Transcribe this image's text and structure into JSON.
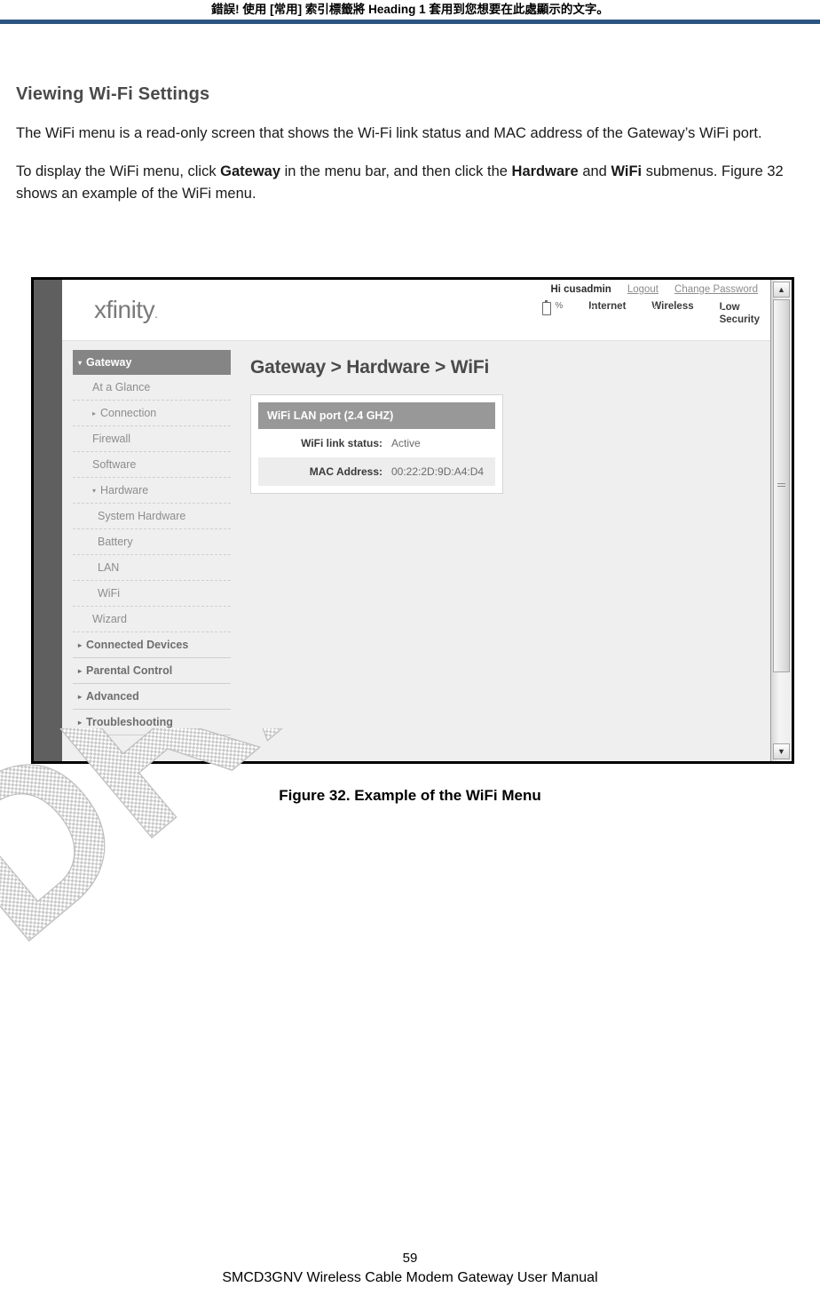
{
  "document": {
    "header_note": "錯誤! 使用 [常用] 索引標籤將 Heading 1 套用到您想要在此處顯示的文字。",
    "rule_color": "#2b5580",
    "section_title": "Viewing Wi-Fi Settings",
    "paragraph_1": "The WiFi menu is a read-only screen that shows the Wi-Fi link status and MAC address of the Gateway’s WiFi port.",
    "paragraph_2_part1": "To display the WiFi menu, click ",
    "paragraph_2_bold1": "Gateway",
    "paragraph_2_part2": " in the menu bar, and then click the ",
    "paragraph_2_bold2": "Hardware",
    "paragraph_2_part3": " and ",
    "paragraph_2_bold3": "WiFi",
    "paragraph_2_part4": " submenus. Figure 32 shows an example of the WiFi menu.",
    "figure_caption": "Figure 32. Example of the WiFi Menu",
    "watermark": "DRAFT",
    "page_number": "59",
    "footer": "SMCD3GNV Wireless Cable Modem Gateway User Manual"
  },
  "screenshot": {
    "logo": "xfinity",
    "logo_dot": ".",
    "topbar": {
      "greeting": "Hi cusadmin",
      "logout": "Logout",
      "change_password": "Change Password",
      "battery_percent": "%",
      "internet": "Internet",
      "wireless": "Wireless",
      "security_line1": "Low",
      "security_line2": "Security"
    },
    "sidebar": {
      "items": [
        {
          "label": "Gateway",
          "level": "top",
          "state": "active",
          "marker": "▾"
        },
        {
          "label": "At a Glance",
          "level": "child",
          "state": "normal",
          "marker": ""
        },
        {
          "label": "Connection",
          "level": "child",
          "state": "normal",
          "marker": "▸"
        },
        {
          "label": "Firewall",
          "level": "child",
          "state": "normal",
          "marker": ""
        },
        {
          "label": "Software",
          "level": "child",
          "state": "normal",
          "marker": ""
        },
        {
          "label": "Hardware",
          "level": "child",
          "state": "expanded",
          "marker": "▾"
        },
        {
          "label": "System Hardware",
          "level": "grandchild",
          "state": "normal",
          "marker": ""
        },
        {
          "label": "Battery",
          "level": "grandchild",
          "state": "normal",
          "marker": ""
        },
        {
          "label": "LAN",
          "level": "grandchild",
          "state": "normal",
          "marker": ""
        },
        {
          "label": "WiFi",
          "level": "grandchild",
          "state": "current",
          "marker": ""
        },
        {
          "label": "Wizard",
          "level": "child",
          "state": "normal",
          "marker": ""
        },
        {
          "label": "Connected Devices",
          "level": "top",
          "state": "normal",
          "marker": "▸"
        },
        {
          "label": "Parental Control",
          "level": "top",
          "state": "normal",
          "marker": "▸"
        },
        {
          "label": "Advanced",
          "level": "top",
          "state": "normal",
          "marker": "▸"
        },
        {
          "label": "Troubleshooting",
          "level": "top",
          "state": "normal",
          "marker": "▸"
        }
      ]
    },
    "main": {
      "breadcrumb": "Gateway > Hardware > WiFi",
      "panel_title": "WiFi LAN port (2.4 GHZ)",
      "rows": [
        {
          "label": "WiFi link status:",
          "value": "Active"
        },
        {
          "label": "MAC Address:",
          "value": "00:22:2D:9D:A4:D4"
        }
      ]
    },
    "scrollbar": {
      "up_arrow": "▲",
      "down_arrow": "▼"
    }
  }
}
